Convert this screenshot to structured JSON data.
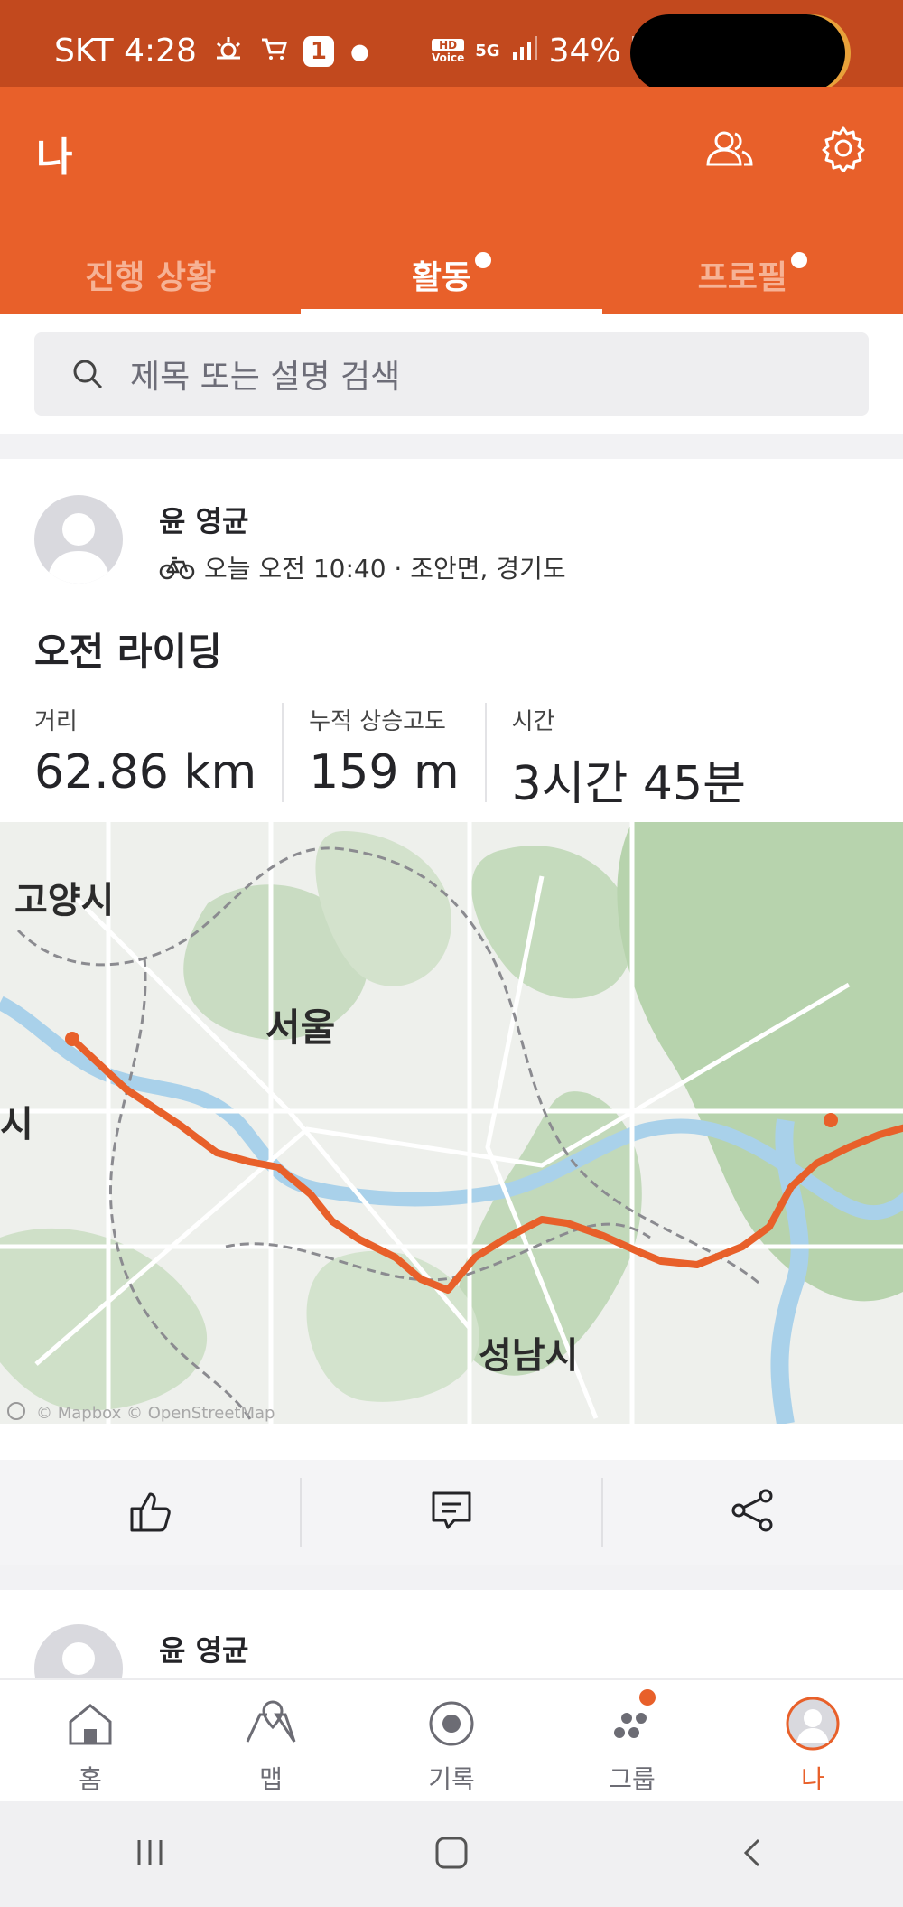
{
  "status_bar": {
    "carrier_time": "SKT 4:28",
    "notification_count": "1",
    "hd_label": "HD",
    "voice_label": "Voice",
    "network": "5G",
    "battery": "34%"
  },
  "header": {
    "title": "나",
    "tabs": [
      {
        "label": "진행 상황",
        "active": false,
        "has_dot": false
      },
      {
        "label": "활동",
        "active": true,
        "has_dot": true
      },
      {
        "label": "프로필",
        "active": false,
        "has_dot": true
      }
    ]
  },
  "search": {
    "placeholder": "제목 또는 설명 검색"
  },
  "activity": {
    "athlete": "윤 영균",
    "meta": "오늘 오전 10:40 · 조안면, 경기도",
    "title": "오전 라이딩",
    "stats": [
      {
        "label": "거리",
        "value": "62.86 km"
      },
      {
        "label": "누적 상승고도",
        "value": "159 m"
      },
      {
        "label": "시간",
        "value": "3시간 45분"
      }
    ],
    "map": {
      "labels": [
        "고양시",
        "서울",
        "시",
        "성남시"
      ],
      "attribution": "© Mapbox © OpenStreetMap",
      "route_color": "#e8602a"
    }
  },
  "next_activity": {
    "athlete": "윤 영균"
  },
  "bottom_nav": [
    {
      "label": "홈",
      "icon": "home-icon"
    },
    {
      "label": "맵",
      "icon": "map-icon"
    },
    {
      "label": "기록",
      "icon": "record-icon"
    },
    {
      "label": "그룹",
      "icon": "groups-icon"
    },
    {
      "label": "나",
      "icon": "profile-icon",
      "active": true
    }
  ],
  "colors": {
    "brand": "#e8602a",
    "status_bar": "#c2491e"
  }
}
